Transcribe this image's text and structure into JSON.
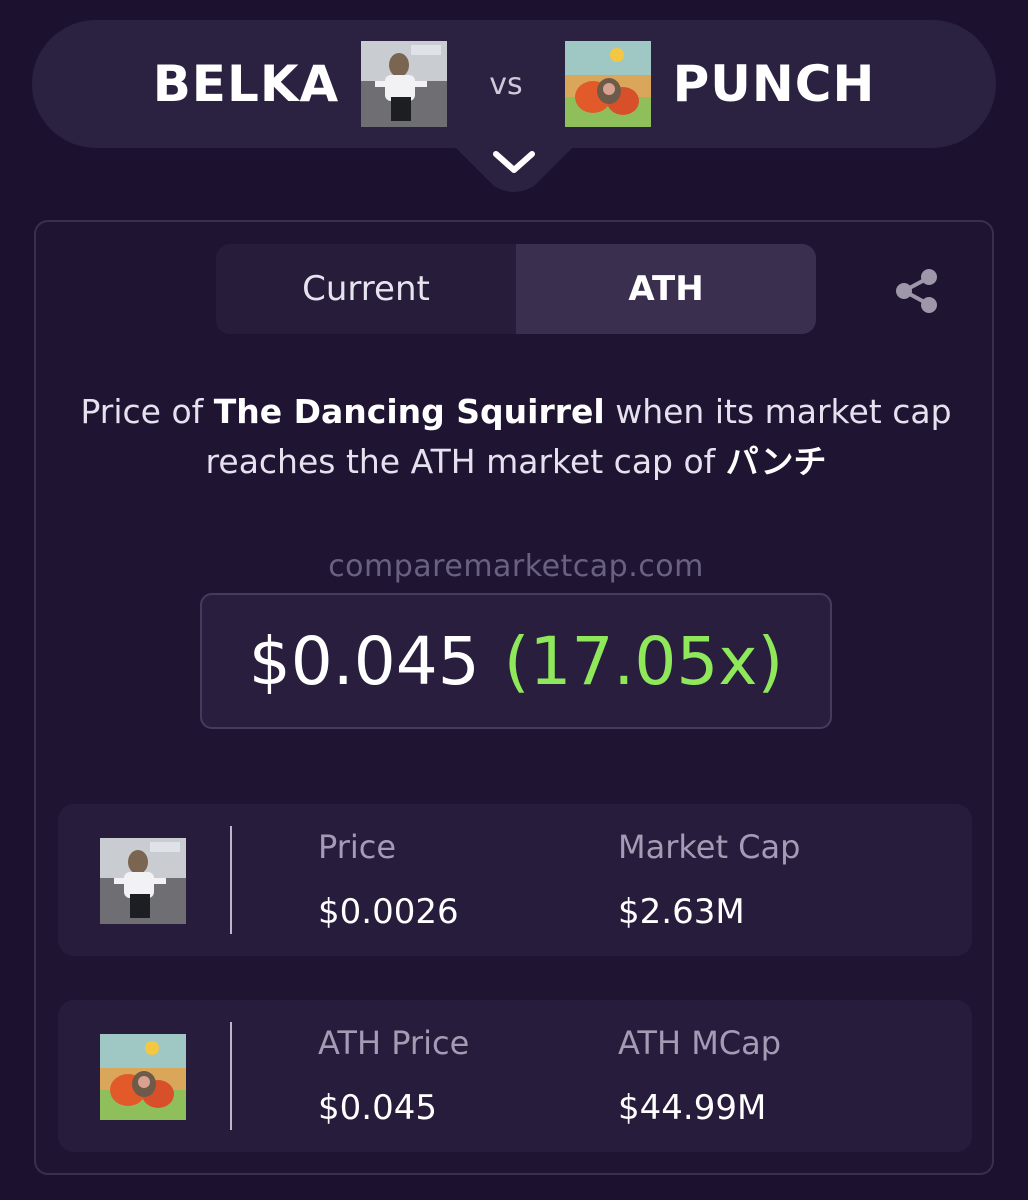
{
  "header": {
    "left_token": "BELKA",
    "vs_label": "vs",
    "right_token": "PUNCH"
  },
  "tabs": {
    "current_label": "Current",
    "ath_label": "ATH",
    "active": "ATH"
  },
  "description": {
    "prefix": "Price of",
    "token_name": "The Dancing Squirrel",
    "middle": "when its market cap",
    "line2": "reaches the ATH market cap of",
    "target_name": "パンチ"
  },
  "site": "comparemarketcap.com",
  "result": {
    "price": "$0.045",
    "multiplier": "(17.05x)"
  },
  "stats": {
    "belka": {
      "price_label": "Price",
      "price_value": "$0.0026",
      "mcap_label": "Market Cap",
      "mcap_value": "$2.63M"
    },
    "punch": {
      "price_label": "ATH Price",
      "price_value": "$0.045",
      "mcap_label": "ATH MCap",
      "mcap_value": "$44.99M"
    }
  },
  "colors": {
    "background": "#1c1230",
    "card": "#271c3b",
    "accent_green": "#8ee85a",
    "muted_text": "#a49bb4"
  },
  "icons": {
    "toggle": "chevron-down-icon",
    "share": "share-icon"
  }
}
